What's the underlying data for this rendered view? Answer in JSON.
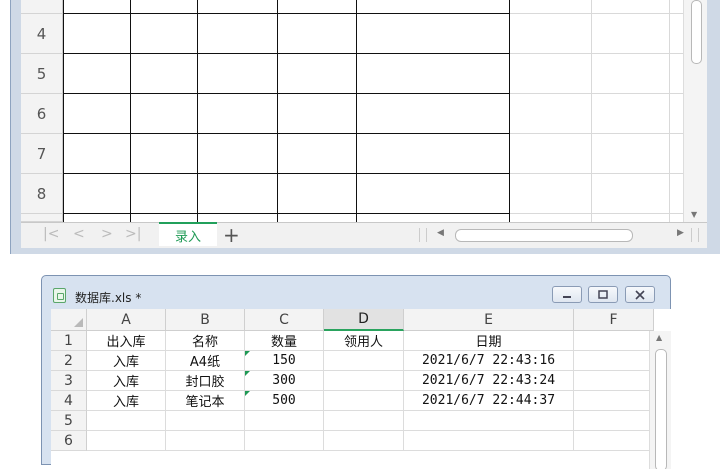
{
  "top_sheet": {
    "row_numbers": [
      "4",
      "5",
      "6",
      "7",
      "8"
    ],
    "tab_label": "录入",
    "add_tab": "+",
    "nav": [
      "|<",
      "<",
      ">",
      ">|"
    ]
  },
  "bottom_window": {
    "title": "数据库.xls *",
    "columns": [
      "A",
      "B",
      "C",
      "D",
      "E",
      "F"
    ],
    "selected_column": "D",
    "row_numbers": [
      "1",
      "2",
      "3",
      "4",
      "5",
      "6"
    ],
    "rows": [
      [
        "出入库",
        "名称",
        "数量",
        "领用人",
        "日期",
        ""
      ],
      [
        "入库",
        "A4纸",
        "150",
        "",
        "2021/6/7 22:43:16",
        ""
      ],
      [
        "入库",
        "封口胶",
        "300",
        "",
        "2021/6/7 22:43:24",
        ""
      ],
      [
        "入库",
        "笔记本",
        "500",
        "",
        "2021/6/7 22:44:37",
        ""
      ],
      [
        "",
        "",
        "",
        "",
        "",
        ""
      ],
      [
        "",
        "",
        "",
        "",
        "",
        ""
      ]
    ]
  },
  "colors": {
    "accent": "#1f9a55",
    "window_frame": "#d7e2f0"
  }
}
